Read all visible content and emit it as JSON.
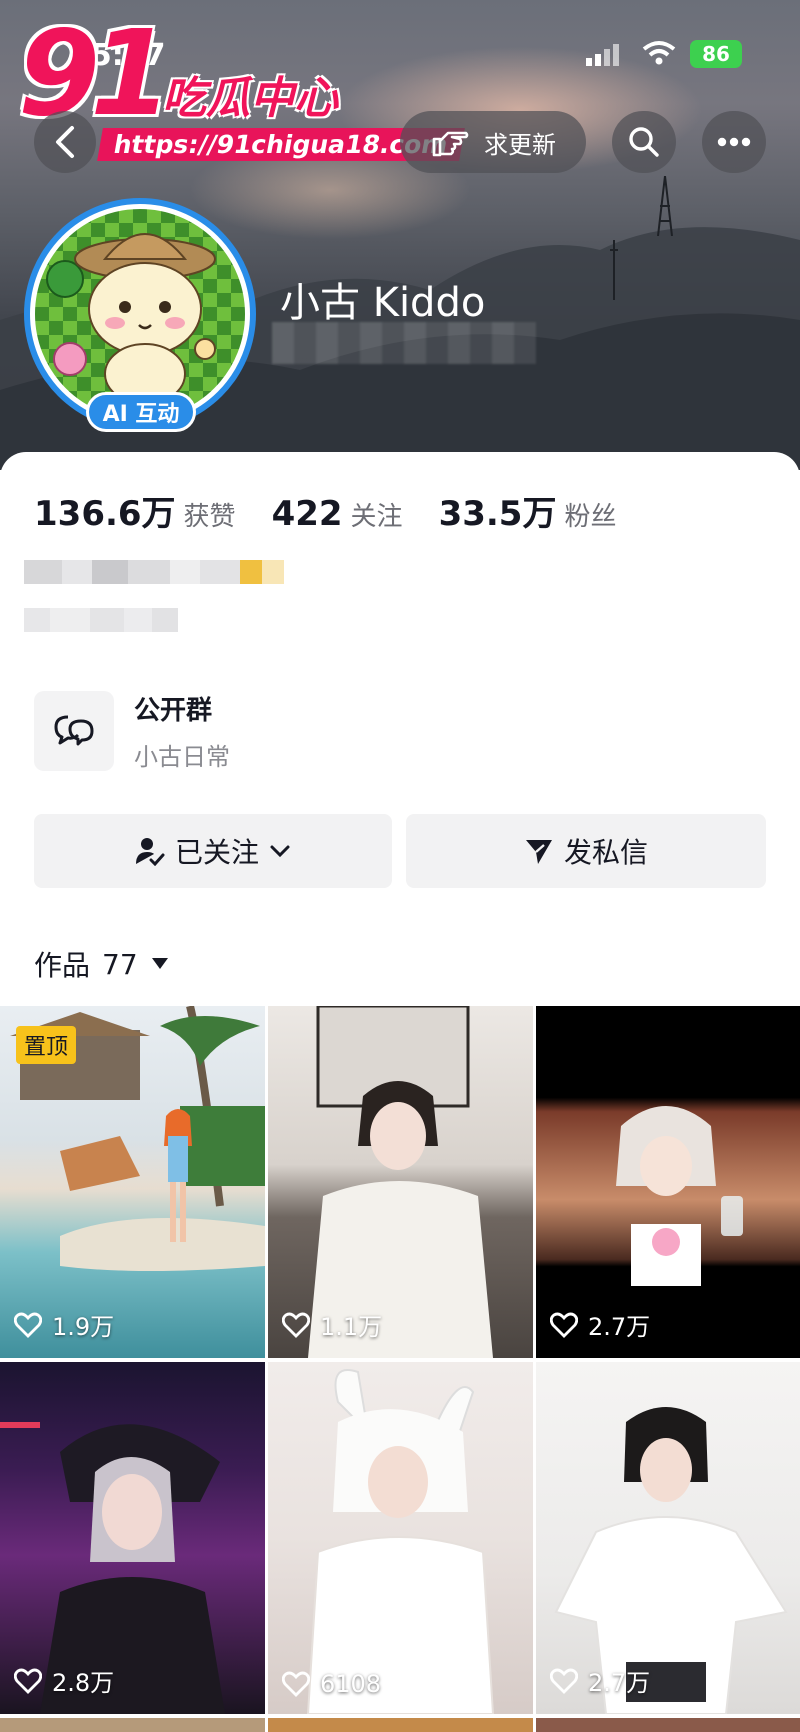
{
  "status_bar": {
    "time": "15:07",
    "battery": "86"
  },
  "watermark": {
    "brand_number": "91",
    "brand_text": "吃瓜中心",
    "url": "https://91chigua18.com"
  },
  "header": {
    "update_label": "求更新"
  },
  "profile": {
    "name": "小古 Kiddo",
    "ai_badge": "AI 互动",
    "stats": [
      {
        "value": "136.6万",
        "label": "获赞"
      },
      {
        "value": "422",
        "label": "关注"
      },
      {
        "value": "33.5万",
        "label": "粉丝"
      }
    ],
    "group": {
      "title": "公开群",
      "subtitle": "小古日常"
    },
    "follow_label": "已关注",
    "message_label": "发私信"
  },
  "works": {
    "label": "作品",
    "count": "77",
    "pinned_label": "置顶",
    "items": [
      {
        "likes": "1.9万"
      },
      {
        "likes": "1.1万"
      },
      {
        "likes": "2.7万"
      },
      {
        "likes": "2.8万"
      },
      {
        "likes": "6108"
      },
      {
        "likes": "2.7万"
      }
    ]
  },
  "colors": {
    "accent_pink": "#f0145a",
    "avatar_ring": "#2a8de8",
    "pin_yellow": "#f7c21b"
  }
}
